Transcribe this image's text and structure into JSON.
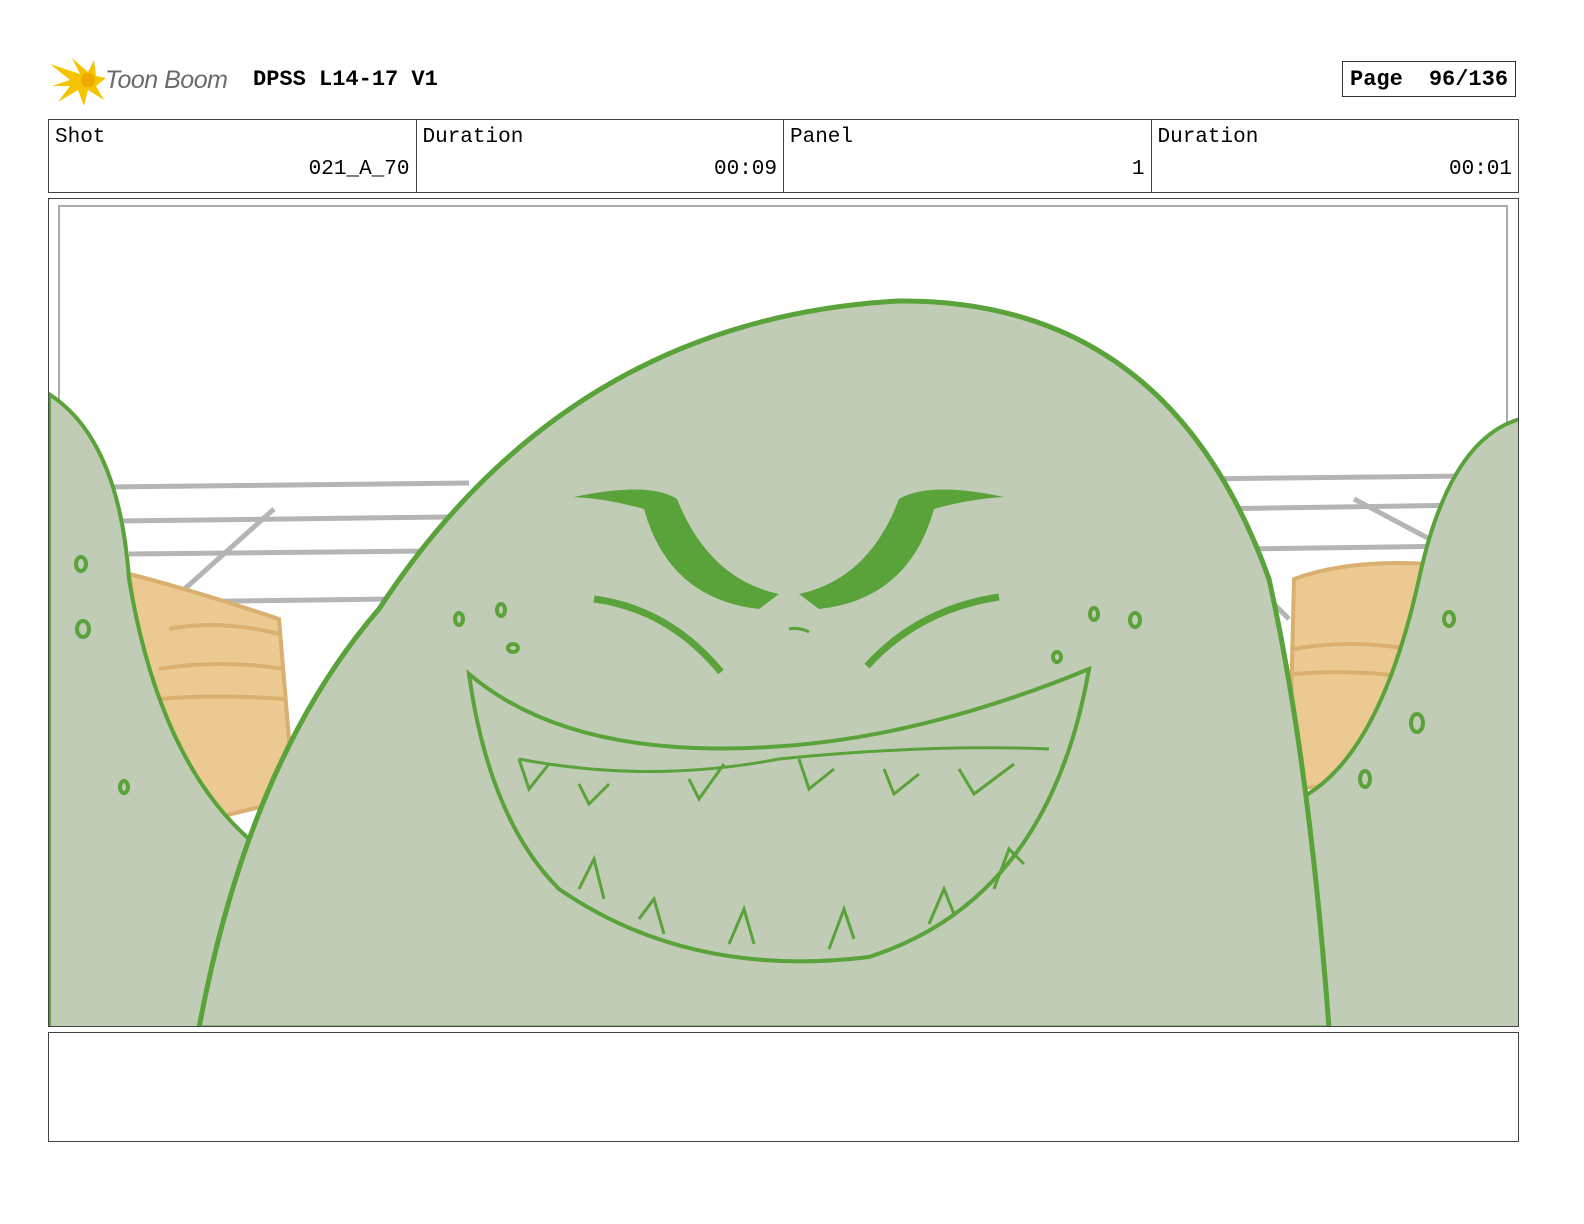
{
  "header": {
    "logo_text": "Toon Boom",
    "title": "DPSS L14-17 V1",
    "page_label": "Page",
    "page_value": "96/136"
  },
  "info": [
    {
      "label": "Shot",
      "value": "021_A_70"
    },
    {
      "label": "Duration",
      "value": "00:09"
    },
    {
      "label": "Panel",
      "value": "1"
    },
    {
      "label": "Duration",
      "value": "00:01"
    }
  ],
  "notes": "",
  "colors": {
    "creature_fill": "#c0ccb5",
    "creature_line": "#5aa23a",
    "skin": "#ebc991",
    "skin_line": "#d9b070",
    "railing": "#b5b5b5",
    "logo_yellow": "#f5c400"
  }
}
